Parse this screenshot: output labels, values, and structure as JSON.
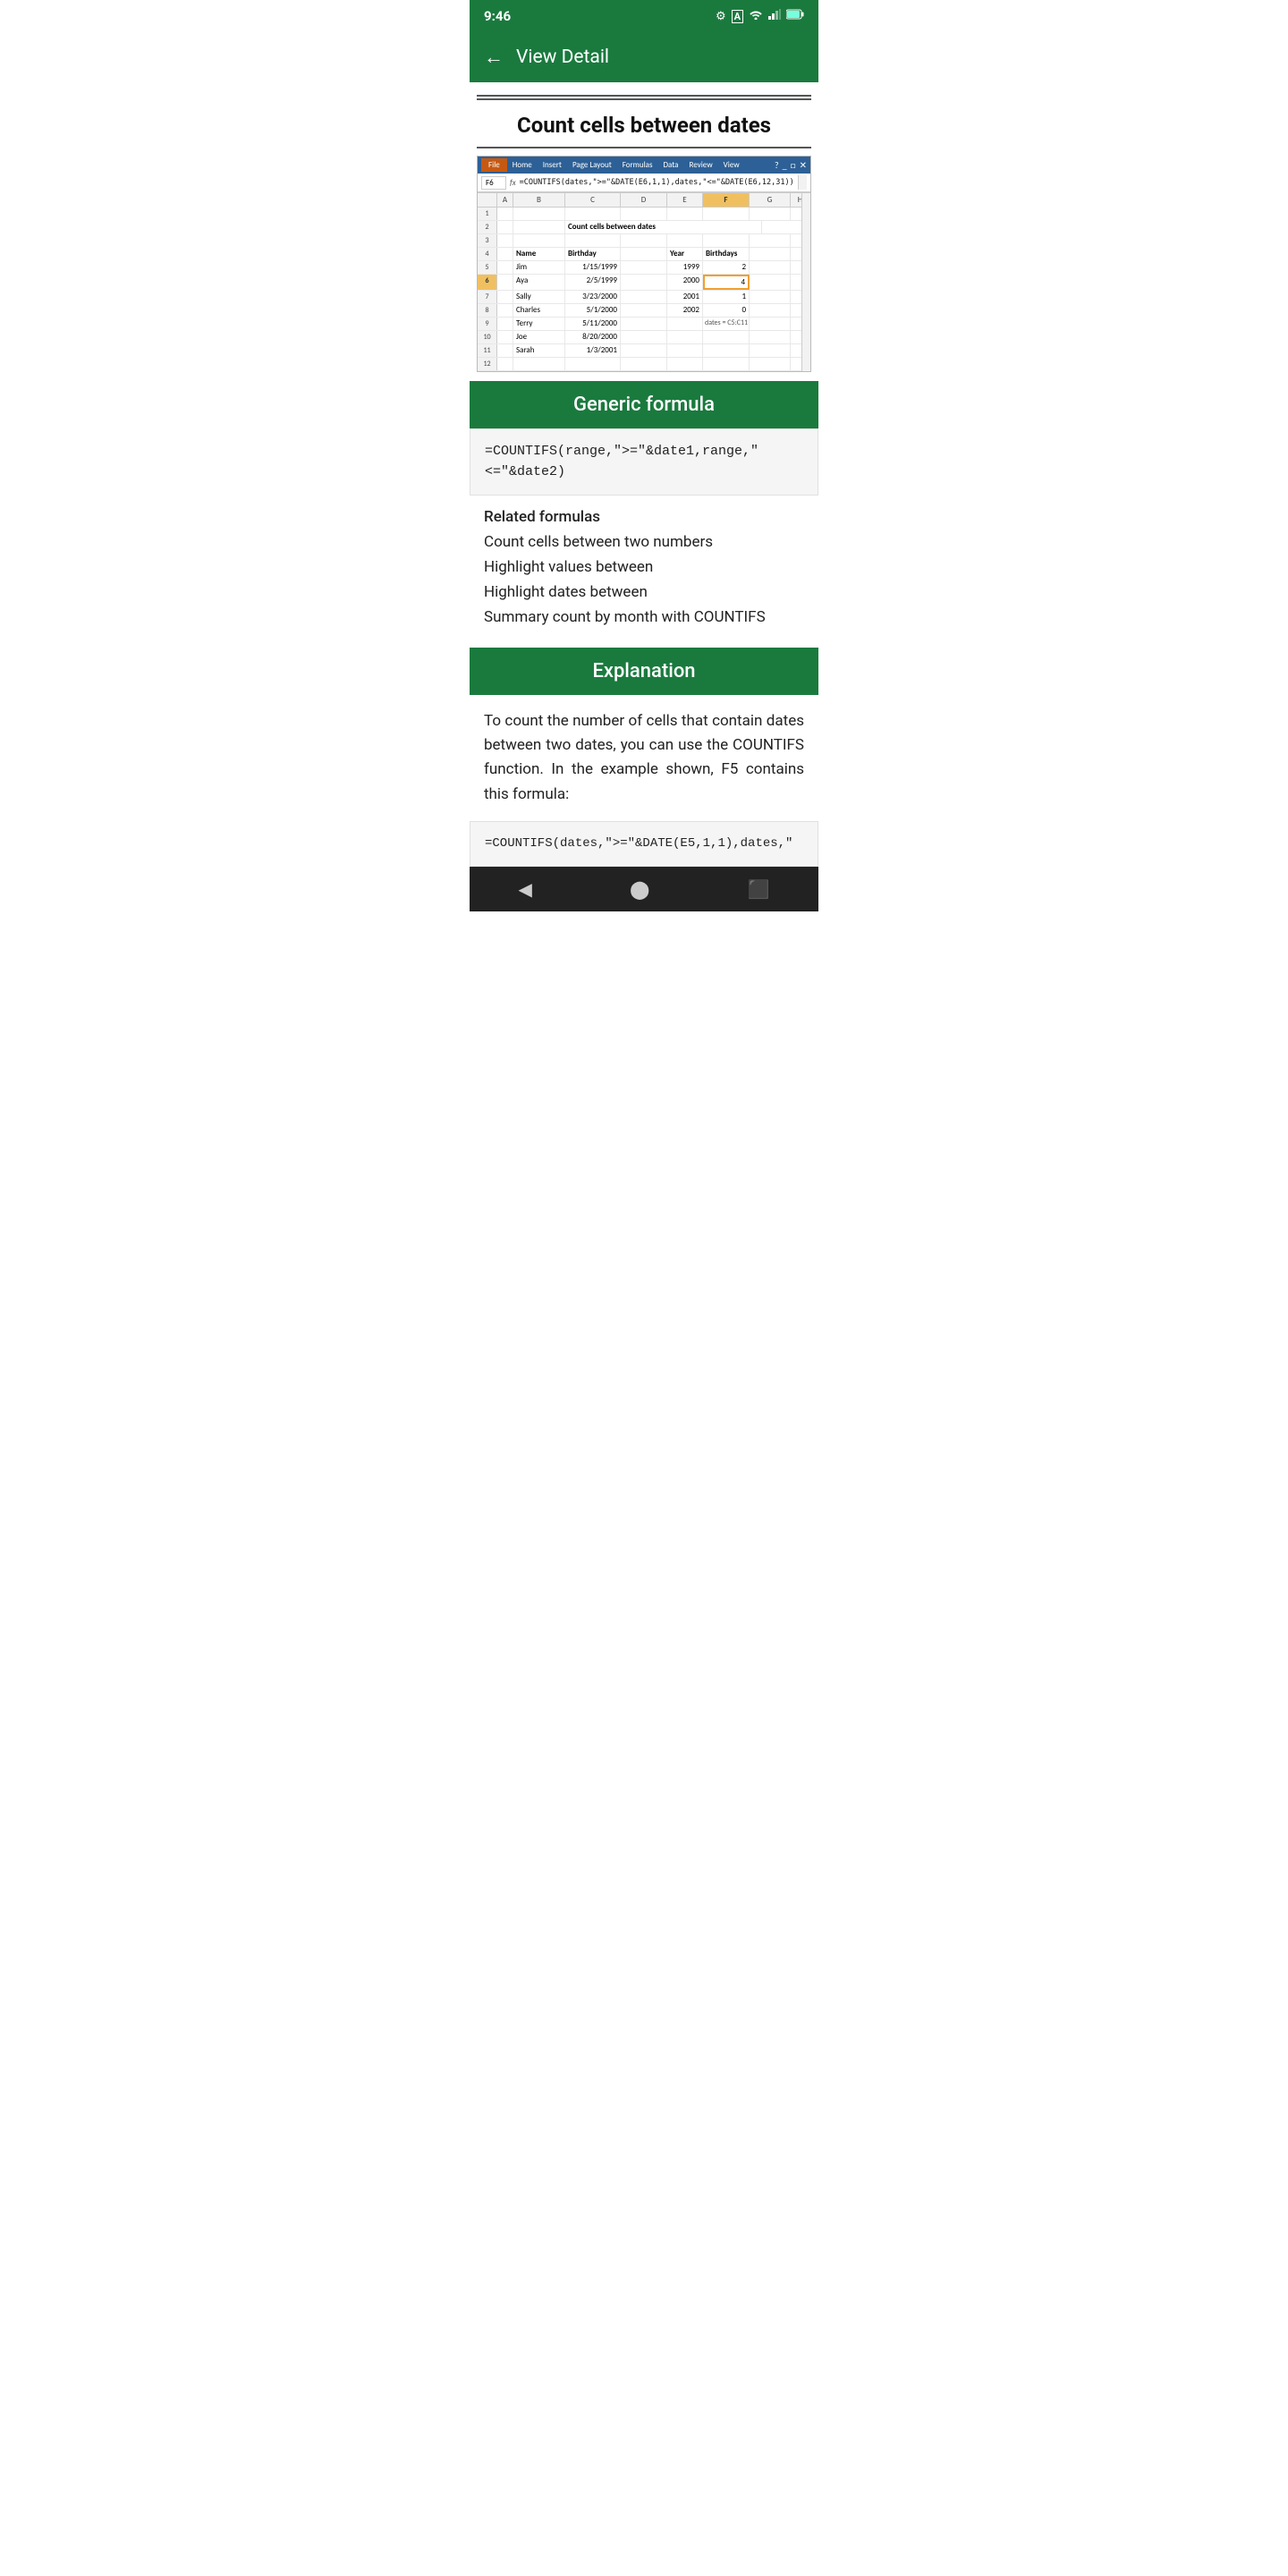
{
  "status_bar": {
    "time": "9:46",
    "icons": [
      "gear",
      "A",
      "wifi",
      "signal",
      "battery"
    ]
  },
  "nav": {
    "title": "View Detail",
    "back_icon": "←"
  },
  "page": {
    "title": "Count cells between dates"
  },
  "spreadsheet": {
    "formula_bar": {
      "cell_ref": "F6",
      "formula": "=COUNTIFS(dates,\">=\"&DATE(E6,1,1),dates,\"<=\"&DATE(E6,12,31))"
    },
    "col_headers": [
      "",
      "A",
      "B",
      "C",
      "D",
      "E",
      "F",
      "G",
      "H"
    ],
    "rows": [
      {
        "num": "1",
        "cells": [
          "",
          "",
          "",
          "",
          "",
          "",
          "",
          "",
          ""
        ]
      },
      {
        "num": "2",
        "cells": [
          "",
          "",
          "Count cells between dates",
          "",
          "",
          "",
          "",
          "",
          ""
        ]
      },
      {
        "num": "3",
        "cells": [
          "",
          "",
          "",
          "",
          "",
          "",
          "",
          "",
          ""
        ]
      },
      {
        "num": "4",
        "cells": [
          "",
          "",
          "Name",
          "Birthday",
          "",
          "Year",
          "Birthdays",
          "",
          ""
        ]
      },
      {
        "num": "5",
        "cells": [
          "",
          "",
          "Jim",
          "1/15/1999",
          "",
          "1999",
          "2",
          "",
          ""
        ]
      },
      {
        "num": "6",
        "cells": [
          "",
          "",
          "Aya",
          "2/5/1999",
          "",
          "2000",
          "4",
          "",
          ""
        ],
        "active": true
      },
      {
        "num": "7",
        "cells": [
          "",
          "",
          "Sally",
          "3/23/2000",
          "",
          "2001",
          "1",
          "",
          ""
        ]
      },
      {
        "num": "8",
        "cells": [
          "",
          "",
          "Charles",
          "5/1/2000",
          "",
          "2002",
          "0",
          "",
          ""
        ]
      },
      {
        "num": "9",
        "cells": [
          "",
          "",
          "Terry",
          "5/11/2000",
          "",
          "",
          "",
          "",
          ""
        ]
      },
      {
        "num": "10",
        "cells": [
          "",
          "",
          "Joe",
          "8/20/2000",
          "",
          "",
          "",
          "",
          ""
        ]
      },
      {
        "num": "11",
        "cells": [
          "",
          "",
          "Sarah",
          "1/3/2001",
          "",
          "",
          "",
          "",
          ""
        ]
      },
      {
        "num": "12",
        "cells": [
          "",
          "",
          "",
          "",
          "",
          "",
          "",
          "",
          ""
        ]
      }
    ],
    "note": "dates = C5:C11"
  },
  "generic_formula": {
    "header": "Generic formula",
    "code": "=COUNTIFS(range,\">=\"&date1,range,\n\"<=\"&date2)"
  },
  "related": {
    "title": "Related formulas",
    "items": [
      "Count cells between two numbers",
      "Highlight values between",
      "Highlight dates between",
      "Summary count by month with COUNTIFS"
    ]
  },
  "explanation": {
    "header": "Explanation",
    "text": "To count the number of cells that contain dates between two dates, you can use the COUNTIFS function. In the example shown, F5 contains this formula:",
    "code": "=COUNTIFS(dates,\">=\"&DATE(E5,1,1),dates,\""
  }
}
